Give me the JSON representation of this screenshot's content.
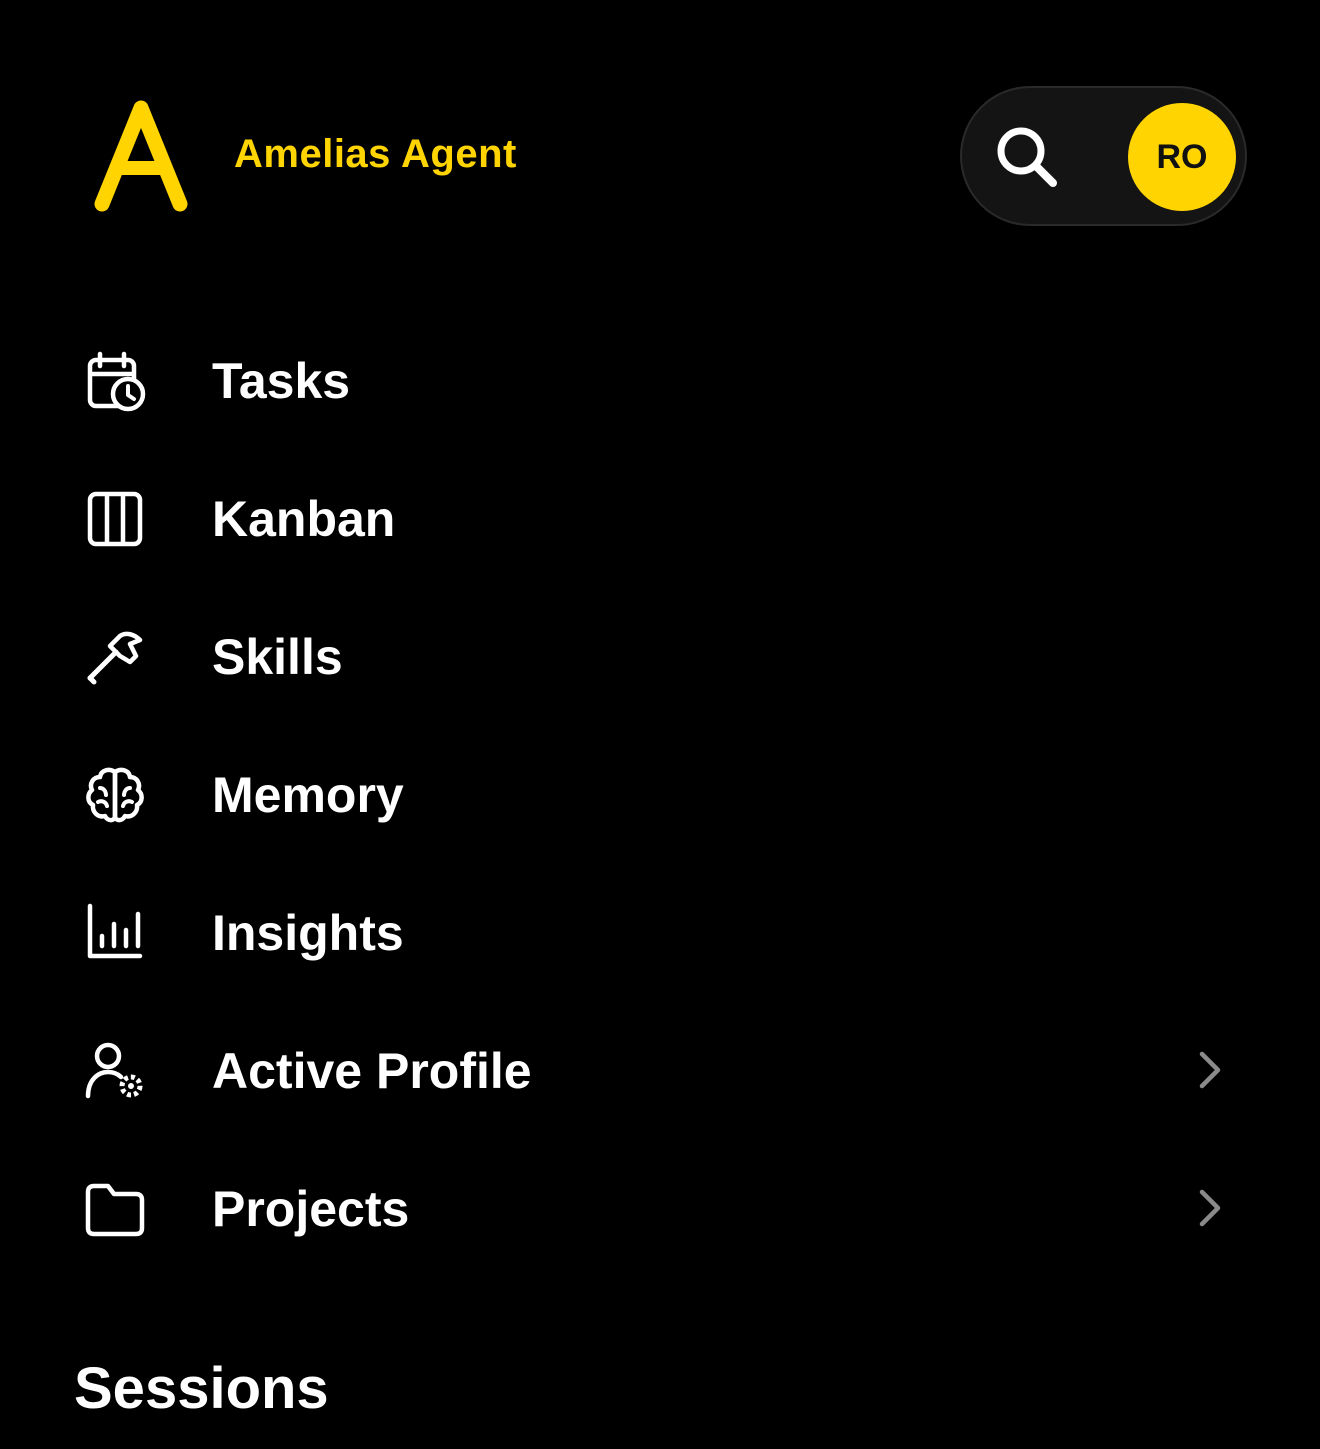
{
  "brand": {
    "logo_letter": "A",
    "name": "Amelias Agent",
    "accent_color": "#FFD400"
  },
  "header": {
    "search_icon": "search-icon",
    "avatar_initials": "RO"
  },
  "nav": {
    "items": [
      {
        "label": "Tasks",
        "icon": "calendar-clock-icon",
        "has_chevron": false
      },
      {
        "label": "Kanban",
        "icon": "columns-icon",
        "has_chevron": false
      },
      {
        "label": "Skills",
        "icon": "hammer-icon",
        "has_chevron": false
      },
      {
        "label": "Memory",
        "icon": "brain-icon",
        "has_chevron": false
      },
      {
        "label": "Insights",
        "icon": "bar-chart-icon",
        "has_chevron": false
      },
      {
        "label": "Active Profile",
        "icon": "user-gear-icon",
        "has_chevron": true
      },
      {
        "label": "Projects",
        "icon": "folder-icon",
        "has_chevron": true
      }
    ]
  },
  "sessions": {
    "heading": "Sessions"
  }
}
